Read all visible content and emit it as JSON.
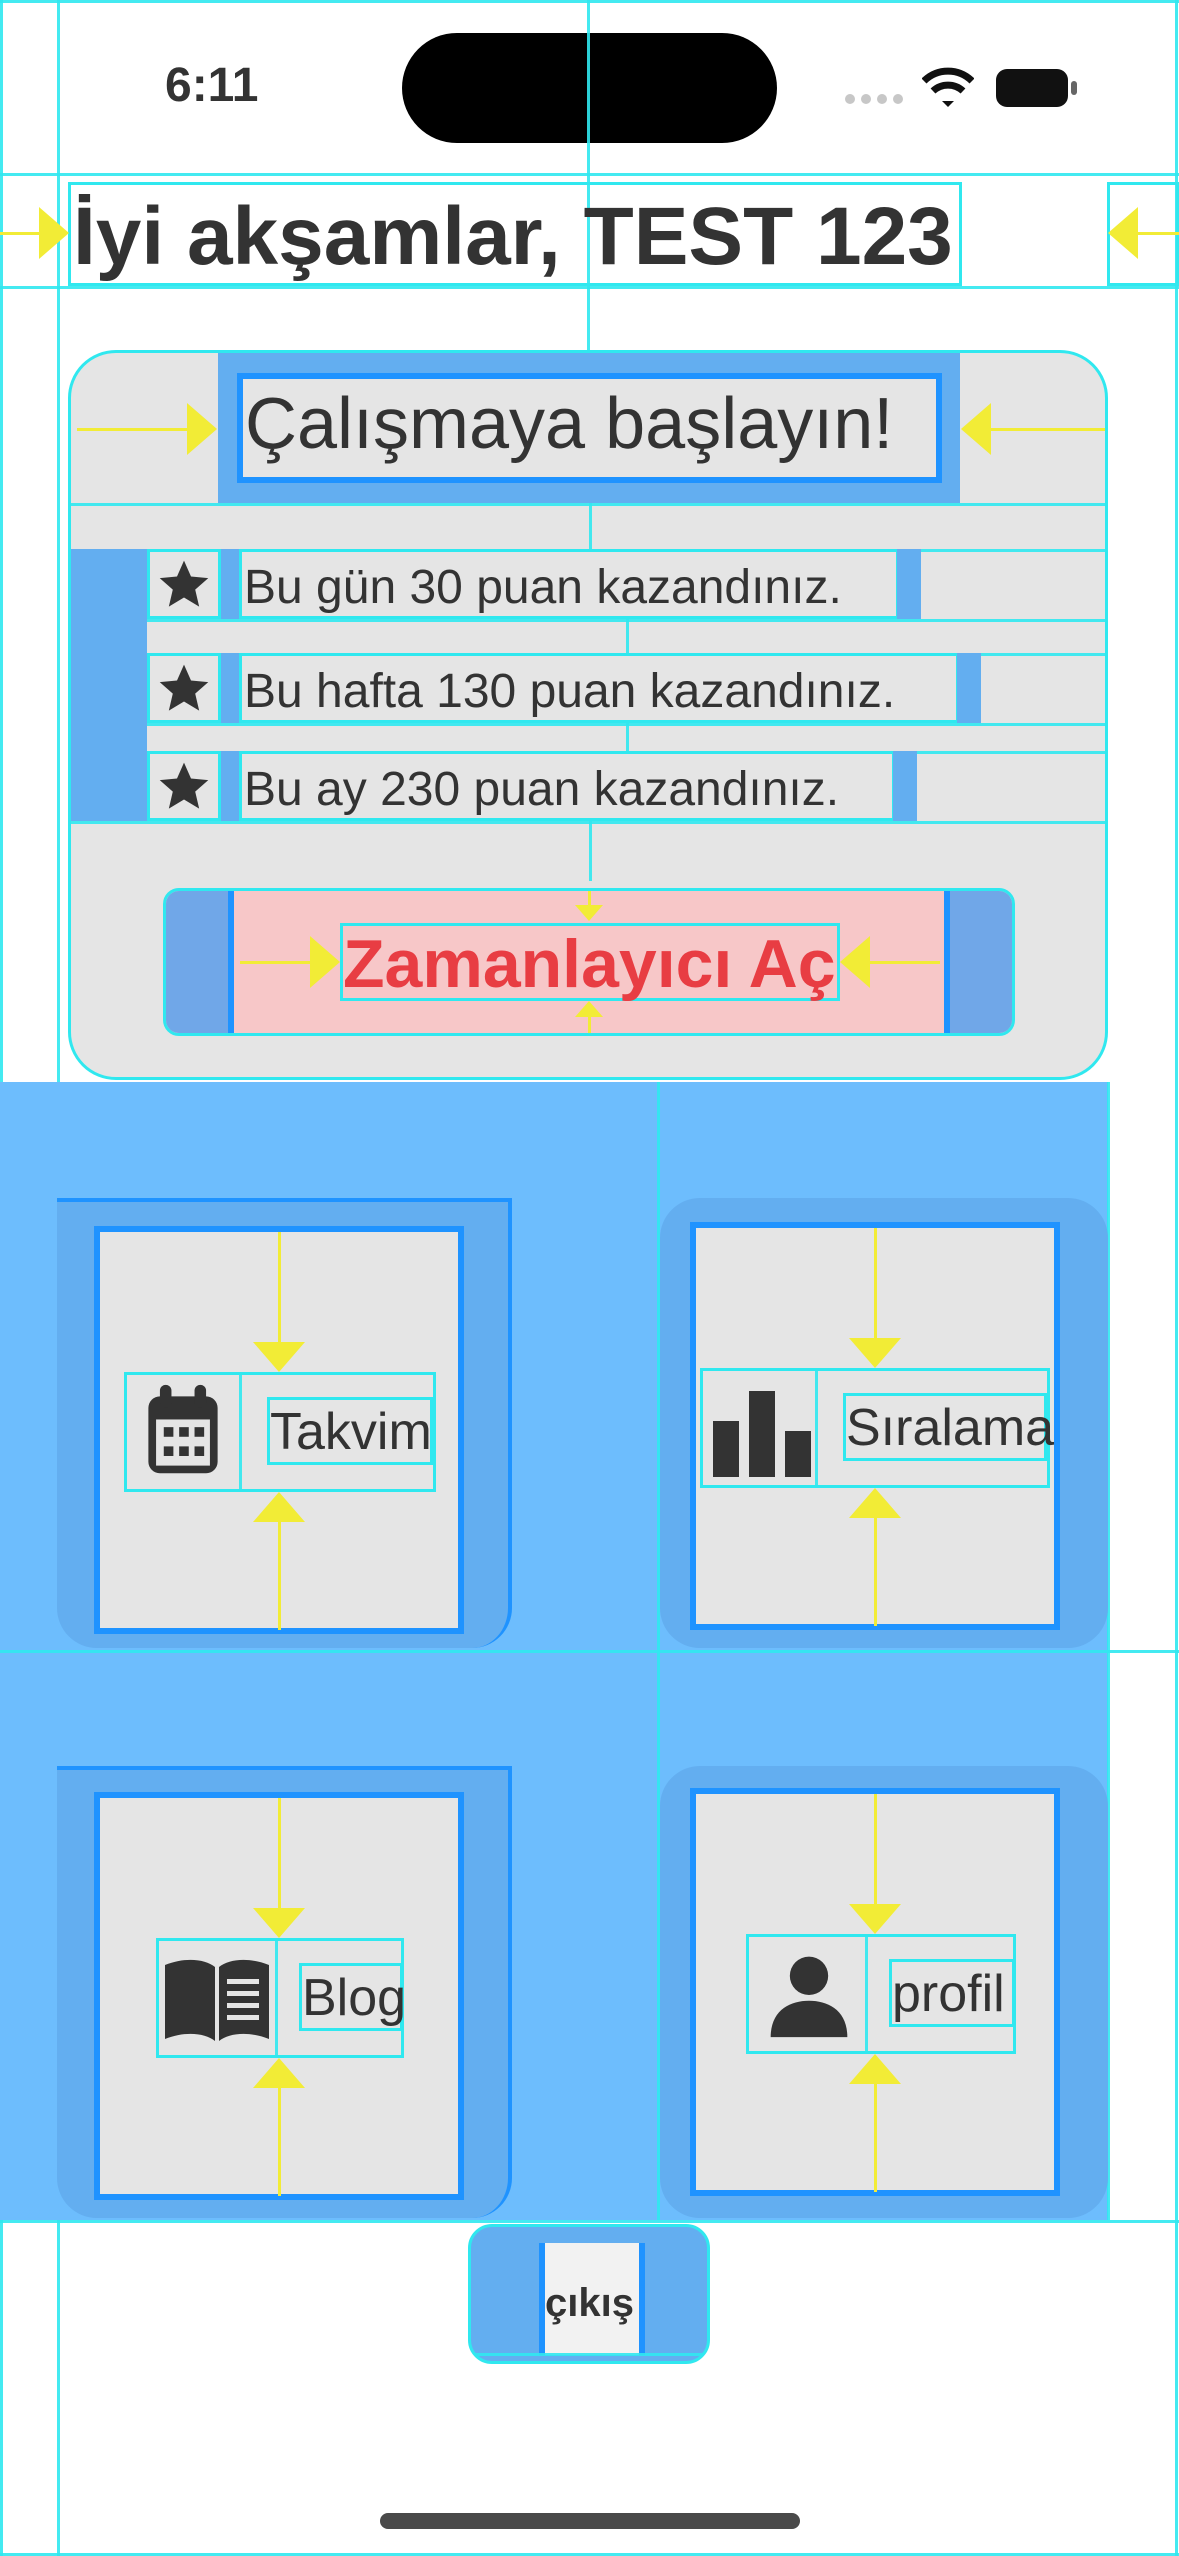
{
  "status_bar": {
    "time": "6:11",
    "icons": [
      "signal-dots-icon",
      "wifi-icon",
      "battery-icon"
    ]
  },
  "greeting": "İyi akşamlar, TEST 123",
  "start_card": {
    "title": "Çalışmaya başlayın!",
    "points": [
      {
        "icon": "star-icon",
        "text": "Bu gün 30 puan kazandınız."
      },
      {
        "icon": "star-icon",
        "text": "Bu hafta 130 puan kazandınız."
      },
      {
        "icon": "star-icon",
        "text": "Bu ay 230 puan kazandınız."
      }
    ],
    "timer_button": "Zamanlayıcı Aç"
  },
  "tiles": [
    {
      "icon": "calendar-icon",
      "label": "Takvim"
    },
    {
      "icon": "bar-chart-icon",
      "label": "Sıralama"
    },
    {
      "icon": "book-icon",
      "label": "Blog"
    },
    {
      "icon": "person-icon",
      "label": "profil"
    }
  ],
  "logout_button": "çıkış",
  "colors": {
    "overlay_blue": "#63aef0",
    "layout_guide": "#30e8ef",
    "constraint_guide": "#f2ec36",
    "card_grey": "#e5e5e5",
    "timer_text": "#e83d43",
    "timer_background": "#f7c7c8"
  }
}
